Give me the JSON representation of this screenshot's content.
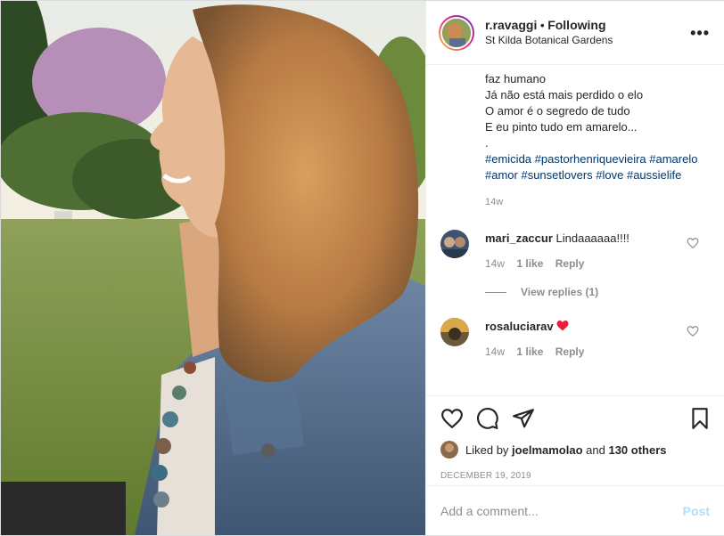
{
  "header": {
    "username": "r.ravaggi",
    "separator": "•",
    "follow_status": "Following",
    "location": "St Kilda Botanical Gardens",
    "more_icon": "more-dots-icon"
  },
  "caption": {
    "lines": [
      "faz humano",
      "Já não está mais perdido o elo",
      "O amor é o segredo de tudo",
      "E eu pinto tudo em amarelo...",
      "."
    ],
    "hashtags": "#emicida #pastorhenriquevieira #amarelo #amor #sunsetlovers #love #aussielife",
    "time": "14w"
  },
  "comments": [
    {
      "user": "mari_zaccur",
      "text": "Lindaaaaaa!!!!",
      "time": "14w",
      "likes": "1 like",
      "reply": "Reply"
    },
    {
      "user": "rosaluciarav",
      "text": "❤️",
      "time": "14w",
      "likes": "1 like",
      "reply": "Reply"
    }
  ],
  "view_replies": "View replies (1)",
  "likes": {
    "prefix": "Liked by",
    "user": "joelmamolao",
    "and": "and",
    "others": "130 others"
  },
  "date": "DECEMBER 19, 2019",
  "add_comment": {
    "placeholder": "Add a comment...",
    "post_label": "Post"
  },
  "colors": {
    "link": "#00376b",
    "heart_red": "#ed4956",
    "post_disabled": "#b2dffc"
  }
}
